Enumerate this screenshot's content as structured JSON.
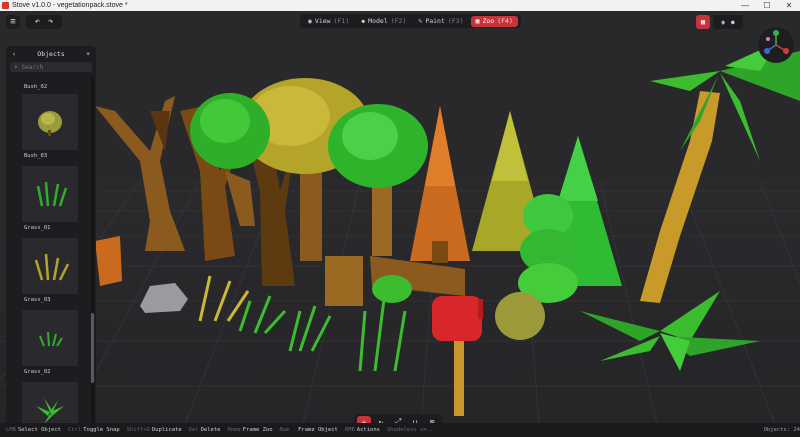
{
  "window": {
    "title": "Stove v1.0.0 - vegetationpack.stove *",
    "controls": [
      "—",
      "☐",
      "✕"
    ]
  },
  "toolbar": {
    "menu_icon": "menu-icon",
    "undo_icon": "undo-icon",
    "redo_icon": "redo-icon",
    "modes": [
      {
        "label": "View",
        "key": "(F1)",
        "icon": "eye-icon"
      },
      {
        "label": "Model",
        "key": "(F2)",
        "icon": "cube-icon"
      },
      {
        "label": "Paint",
        "key": "(F3)",
        "icon": "brush-icon"
      },
      {
        "label": "Zoo",
        "key": "(F4)",
        "icon": "grid-icon",
        "active": true
      }
    ],
    "accent": "#c8323a"
  },
  "panel": {
    "title": "Objects",
    "search_placeholder": "Search",
    "items": [
      {
        "label": "Bush_02",
        "thumb": false
      },
      {
        "label": "Bush_03",
        "thumb": "bush"
      },
      {
        "label": "Grass_01",
        "thumb": "grass"
      },
      {
        "label": "Grass_03",
        "thumb": "grass-yellow"
      },
      {
        "label": "Grass_02",
        "thumb": "grass-small"
      },
      {
        "label": "",
        "thumb": "fern"
      }
    ]
  },
  "status": {
    "hints": [
      {
        "key": "LMB",
        "action": "Select Object"
      },
      {
        "key": "Ctrl",
        "action": "Toggle Snap"
      },
      {
        "key": "Shift+D",
        "action": "Duplicate"
      },
      {
        "key": "Del",
        "action": "Delete"
      },
      {
        "key": "Home",
        "action": "Frame Zoo"
      },
      {
        "key": "Num .",
        "action": "Frame Object"
      },
      {
        "key": "RMB",
        "action": "Actions"
      }
    ],
    "shading": "Shadeless on...",
    "objects": "Objects: 24"
  }
}
